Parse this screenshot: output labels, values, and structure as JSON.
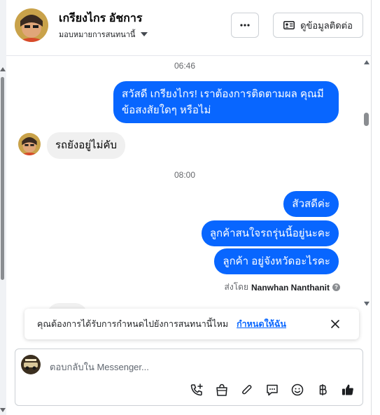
{
  "header": {
    "contact_name": "เกรียงไกร อัชการ",
    "assign_label": "มอบหมายการสนทนานี้",
    "more_label": "···",
    "contact_info_label": "ดูข้อมูลติดต่อ"
  },
  "conversation": {
    "time_1": "06:46",
    "out_msg_1_line1": "สวัสดี เกรียงไกร! เราต้องการติดตามผล คุณมี",
    "out_msg_1_line2": "ข้อสงสัยใดๆ หรือไม่",
    "in_msg_1": "รถยังอยู่ไม่คับ",
    "time_2": "08:00",
    "out_msg_2": "สัวสดีค่ะ",
    "out_msg_3": "ลูกค้าสนใจรถรุ่นนี้อยู่นะคะ",
    "out_msg_4": "ลูกค้า อยู่จังหวัดอะไรคะ",
    "sent_by_prefix": "ส่งโดย",
    "sent_by_name": "Nanwhan Nanthanit"
  },
  "notice": {
    "text": "คุณต้องการได้รับการกำหนดไปยังการสนทนานี้ไหม",
    "link": "กำหนดให้ฉัน"
  },
  "composer": {
    "placeholder": "ตอบกลับใน Messenger..."
  },
  "icons": {
    "tools": [
      "add-call-icon",
      "shopping-bag-icon",
      "attachment-icon",
      "saved-reply-icon",
      "emoji-icon",
      "baht-icon",
      "thumbs-up-icon"
    ]
  },
  "colors": {
    "accent": "#0866ff",
    "bubble_in": "#f0f0f0"
  }
}
